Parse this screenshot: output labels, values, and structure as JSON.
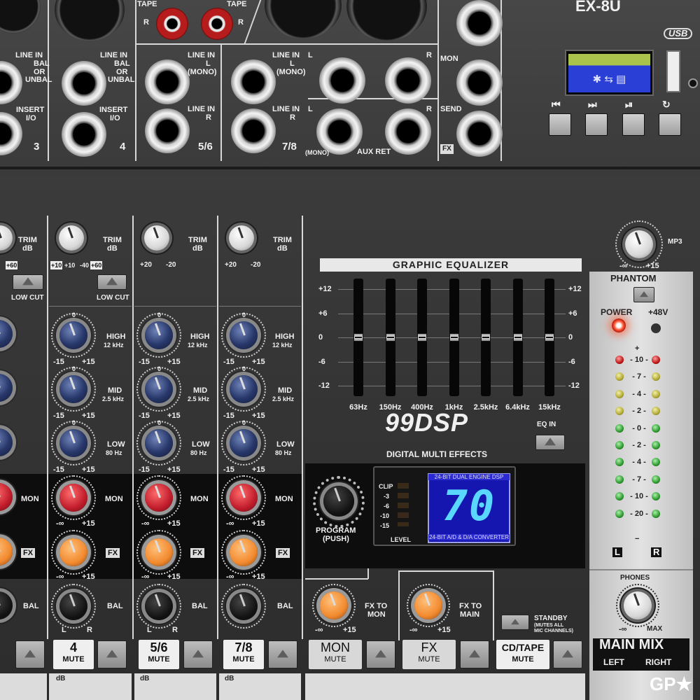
{
  "header": {
    "model": "EX-8U",
    "usb_label": "USB"
  },
  "top_panel": {
    "tape_label": "TAPE",
    "line_in_bal": [
      "LINE IN",
      "BAL",
      "OR",
      "UNBAL"
    ],
    "insert": [
      "INSERT",
      "I/O"
    ],
    "line_in_l_mono": [
      "LINE IN",
      "L",
      "(MONO)"
    ],
    "line_in_r": [
      "LINE IN",
      "R"
    ],
    "ch3": "3",
    "ch4": "4",
    "ch56": "5/6",
    "ch78": "7/8",
    "aux_ret": "AUX RET",
    "mono": "(MONO)",
    "mon": "MON",
    "send": "SEND",
    "fx": "FX",
    "l": "L",
    "r": "R"
  },
  "media_player": {
    "display_text": "✱ ⇆ ▤",
    "buttons": [
      "prev",
      "next",
      "play-pause",
      "repeat"
    ],
    "button_glyphs": [
      "⏮",
      "⏭",
      "⏯",
      "↻"
    ]
  },
  "channel_strip": {
    "trim": [
      "TRIM",
      "dB"
    ],
    "trim_scale_mono": [
      "+10",
      "+10",
      "-40",
      "+60"
    ],
    "trim_scale_stereo": [
      "+20",
      "-20"
    ],
    "low_cut": "LOW CUT",
    "high": [
      "HIGH",
      "12 kHz"
    ],
    "mid": [
      "MID",
      "2.5 kHz"
    ],
    "low": [
      "LOW",
      "80 Hz"
    ],
    "scale": [
      "-15",
      "+15"
    ],
    "zero": "0",
    "mon": "MON",
    "fx": "FX",
    "bal": "BAL",
    "inf_scale": [
      "-∞",
      "+15"
    ],
    "bal_lr": [
      "L",
      "R"
    ],
    "mute": "MUTE",
    "db": "dB",
    "channel_names": [
      "4",
      "5/6",
      "7/8"
    ]
  },
  "graphic_eq": {
    "title": "GRAPHIC EQUALIZER",
    "levels": [
      "+12",
      "+6",
      "0",
      "-6",
      "-12"
    ],
    "bands": [
      "63Hz",
      "150Hz",
      "400Hz",
      "1kHz",
      "2.5kHz",
      "6.4kHz",
      "15kHz"
    ],
    "eq_in": "EQ IN"
  },
  "dsp": {
    "logo": "99DSP",
    "subtitle": "DIGITAL MULTI EFFECTS",
    "program_label": [
      "PROGRAM",
      "(PUSH)"
    ],
    "clip_levels": [
      "CLIP",
      "-3",
      "-6",
      "-10",
      "-15"
    ],
    "level_label": "LEVEL",
    "banner_top": "24-BIT DUAL ENGINE DSP",
    "banner_bottom": "24-BIT A/D & D/A CONVERTER",
    "program_number": "70"
  },
  "master": {
    "mp3": "MP3",
    "mp3_scale": [
      "-∞",
      "+15"
    ],
    "phantom": "PHANTOM",
    "power": "POWER",
    "plus48v": "+48V",
    "meter_plus": "+",
    "meter_minus": "−",
    "meter_levels": [
      "10",
      "7",
      "4",
      "2",
      "0",
      "2",
      "4",
      "7",
      "10",
      "20"
    ],
    "meter_l": "L",
    "meter_r": "R",
    "phones": "PHONES",
    "phones_scale": [
      "-∞",
      "MAX"
    ],
    "fx_to_mon": [
      "FX TO",
      "MON"
    ],
    "fx_to_main": [
      "FX TO",
      "MAIN"
    ],
    "fx_scale": [
      "-∞",
      "+15"
    ],
    "standby": [
      "STANDBY",
      "(MUTES ALL",
      "MIC CHANNELS)"
    ],
    "mon_mute": [
      "MON",
      "MUTE"
    ],
    "fx_mute": [
      "FX",
      "MUTE"
    ],
    "cdtape_mute": [
      "CD/TAPE",
      "MUTE"
    ],
    "main_mix": [
      "MAIN MIX",
      "LEFT",
      "RIGHT"
    ]
  },
  "watermark": "GP★",
  "colors": {
    "led_red": "#c01616",
    "led_yellow": "#b3aa33",
    "led_green": "#2f9a2f",
    "dsp_blue": "#1515b0",
    "knob_blue": "#27376a",
    "knob_red": "#c01c2b",
    "knob_orange": "#f28a2f"
  }
}
